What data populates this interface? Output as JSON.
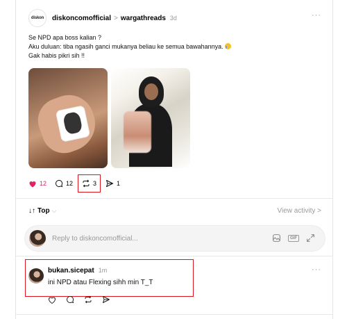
{
  "post": {
    "username": "diskoncomofficial",
    "community": "wargathreads",
    "time": "3d",
    "more": "···",
    "avatar_logo": "diskon",
    "lines": [
      "Se NPD apa boss kalian ?",
      "Aku duluan: tiba ngasih ganci mukanya beliau ke semua bawahannya.",
      "Gak habis pikri sih !!"
    ],
    "emoji": "crying-face-icon",
    "actions": {
      "likes": "12",
      "comments": "12",
      "reposts": "3",
      "shares": "1"
    }
  },
  "thread": {
    "sort_label": "Top",
    "view_activity": "View activity",
    "reply_placeholder": "Reply to diskoncomofficial...",
    "gif_label": "GIF"
  },
  "comment": {
    "username": "bukan.sicepat",
    "time": "1m",
    "text": "ini NPD atau Flexing sihh min T_T",
    "more": "···"
  },
  "colors": {
    "like": "#e0245e",
    "highlight": "#e0141e",
    "muted": "#999999"
  }
}
